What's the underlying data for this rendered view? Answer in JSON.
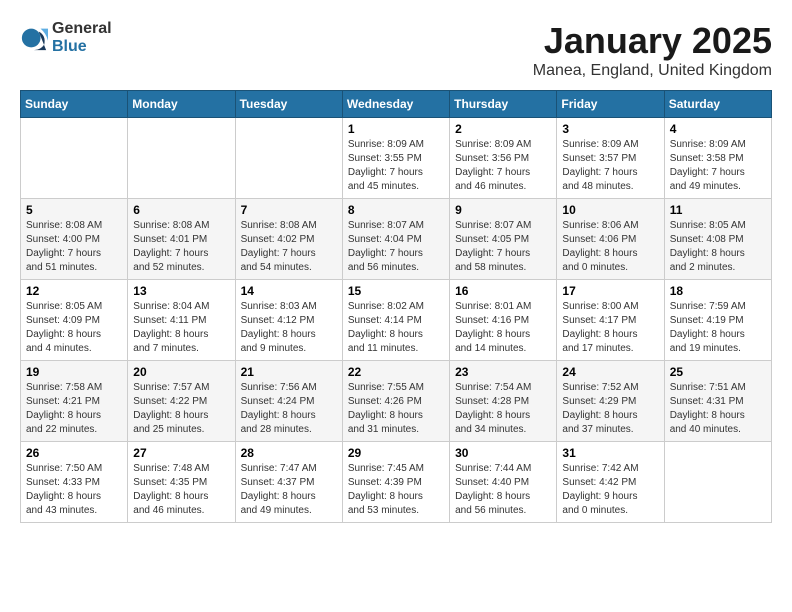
{
  "header": {
    "logo_general": "General",
    "logo_blue": "Blue",
    "month": "January 2025",
    "location": "Manea, England, United Kingdom"
  },
  "weekdays": [
    "Sunday",
    "Monday",
    "Tuesday",
    "Wednesday",
    "Thursday",
    "Friday",
    "Saturday"
  ],
  "weeks": [
    [
      {
        "day": "",
        "info": ""
      },
      {
        "day": "",
        "info": ""
      },
      {
        "day": "",
        "info": ""
      },
      {
        "day": "1",
        "info": "Sunrise: 8:09 AM\nSunset: 3:55 PM\nDaylight: 7 hours\nand 45 minutes."
      },
      {
        "day": "2",
        "info": "Sunrise: 8:09 AM\nSunset: 3:56 PM\nDaylight: 7 hours\nand 46 minutes."
      },
      {
        "day": "3",
        "info": "Sunrise: 8:09 AM\nSunset: 3:57 PM\nDaylight: 7 hours\nand 48 minutes."
      },
      {
        "day": "4",
        "info": "Sunrise: 8:09 AM\nSunset: 3:58 PM\nDaylight: 7 hours\nand 49 minutes."
      }
    ],
    [
      {
        "day": "5",
        "info": "Sunrise: 8:08 AM\nSunset: 4:00 PM\nDaylight: 7 hours\nand 51 minutes."
      },
      {
        "day": "6",
        "info": "Sunrise: 8:08 AM\nSunset: 4:01 PM\nDaylight: 7 hours\nand 52 minutes."
      },
      {
        "day": "7",
        "info": "Sunrise: 8:08 AM\nSunset: 4:02 PM\nDaylight: 7 hours\nand 54 minutes."
      },
      {
        "day": "8",
        "info": "Sunrise: 8:07 AM\nSunset: 4:04 PM\nDaylight: 7 hours\nand 56 minutes."
      },
      {
        "day": "9",
        "info": "Sunrise: 8:07 AM\nSunset: 4:05 PM\nDaylight: 7 hours\nand 58 minutes."
      },
      {
        "day": "10",
        "info": "Sunrise: 8:06 AM\nSunset: 4:06 PM\nDaylight: 8 hours\nand 0 minutes."
      },
      {
        "day": "11",
        "info": "Sunrise: 8:05 AM\nSunset: 4:08 PM\nDaylight: 8 hours\nand 2 minutes."
      }
    ],
    [
      {
        "day": "12",
        "info": "Sunrise: 8:05 AM\nSunset: 4:09 PM\nDaylight: 8 hours\nand 4 minutes."
      },
      {
        "day": "13",
        "info": "Sunrise: 8:04 AM\nSunset: 4:11 PM\nDaylight: 8 hours\nand 7 minutes."
      },
      {
        "day": "14",
        "info": "Sunrise: 8:03 AM\nSunset: 4:12 PM\nDaylight: 8 hours\nand 9 minutes."
      },
      {
        "day": "15",
        "info": "Sunrise: 8:02 AM\nSunset: 4:14 PM\nDaylight: 8 hours\nand 11 minutes."
      },
      {
        "day": "16",
        "info": "Sunrise: 8:01 AM\nSunset: 4:16 PM\nDaylight: 8 hours\nand 14 minutes."
      },
      {
        "day": "17",
        "info": "Sunrise: 8:00 AM\nSunset: 4:17 PM\nDaylight: 8 hours\nand 17 minutes."
      },
      {
        "day": "18",
        "info": "Sunrise: 7:59 AM\nSunset: 4:19 PM\nDaylight: 8 hours\nand 19 minutes."
      }
    ],
    [
      {
        "day": "19",
        "info": "Sunrise: 7:58 AM\nSunset: 4:21 PM\nDaylight: 8 hours\nand 22 minutes."
      },
      {
        "day": "20",
        "info": "Sunrise: 7:57 AM\nSunset: 4:22 PM\nDaylight: 8 hours\nand 25 minutes."
      },
      {
        "day": "21",
        "info": "Sunrise: 7:56 AM\nSunset: 4:24 PM\nDaylight: 8 hours\nand 28 minutes."
      },
      {
        "day": "22",
        "info": "Sunrise: 7:55 AM\nSunset: 4:26 PM\nDaylight: 8 hours\nand 31 minutes."
      },
      {
        "day": "23",
        "info": "Sunrise: 7:54 AM\nSunset: 4:28 PM\nDaylight: 8 hours\nand 34 minutes."
      },
      {
        "day": "24",
        "info": "Sunrise: 7:52 AM\nSunset: 4:29 PM\nDaylight: 8 hours\nand 37 minutes."
      },
      {
        "day": "25",
        "info": "Sunrise: 7:51 AM\nSunset: 4:31 PM\nDaylight: 8 hours\nand 40 minutes."
      }
    ],
    [
      {
        "day": "26",
        "info": "Sunrise: 7:50 AM\nSunset: 4:33 PM\nDaylight: 8 hours\nand 43 minutes."
      },
      {
        "day": "27",
        "info": "Sunrise: 7:48 AM\nSunset: 4:35 PM\nDaylight: 8 hours\nand 46 minutes."
      },
      {
        "day": "28",
        "info": "Sunrise: 7:47 AM\nSunset: 4:37 PM\nDaylight: 8 hours\nand 49 minutes."
      },
      {
        "day": "29",
        "info": "Sunrise: 7:45 AM\nSunset: 4:39 PM\nDaylight: 8 hours\nand 53 minutes."
      },
      {
        "day": "30",
        "info": "Sunrise: 7:44 AM\nSunset: 4:40 PM\nDaylight: 8 hours\nand 56 minutes."
      },
      {
        "day": "31",
        "info": "Sunrise: 7:42 AM\nSunset: 4:42 PM\nDaylight: 9 hours\nand 0 minutes."
      },
      {
        "day": "",
        "info": ""
      }
    ]
  ]
}
